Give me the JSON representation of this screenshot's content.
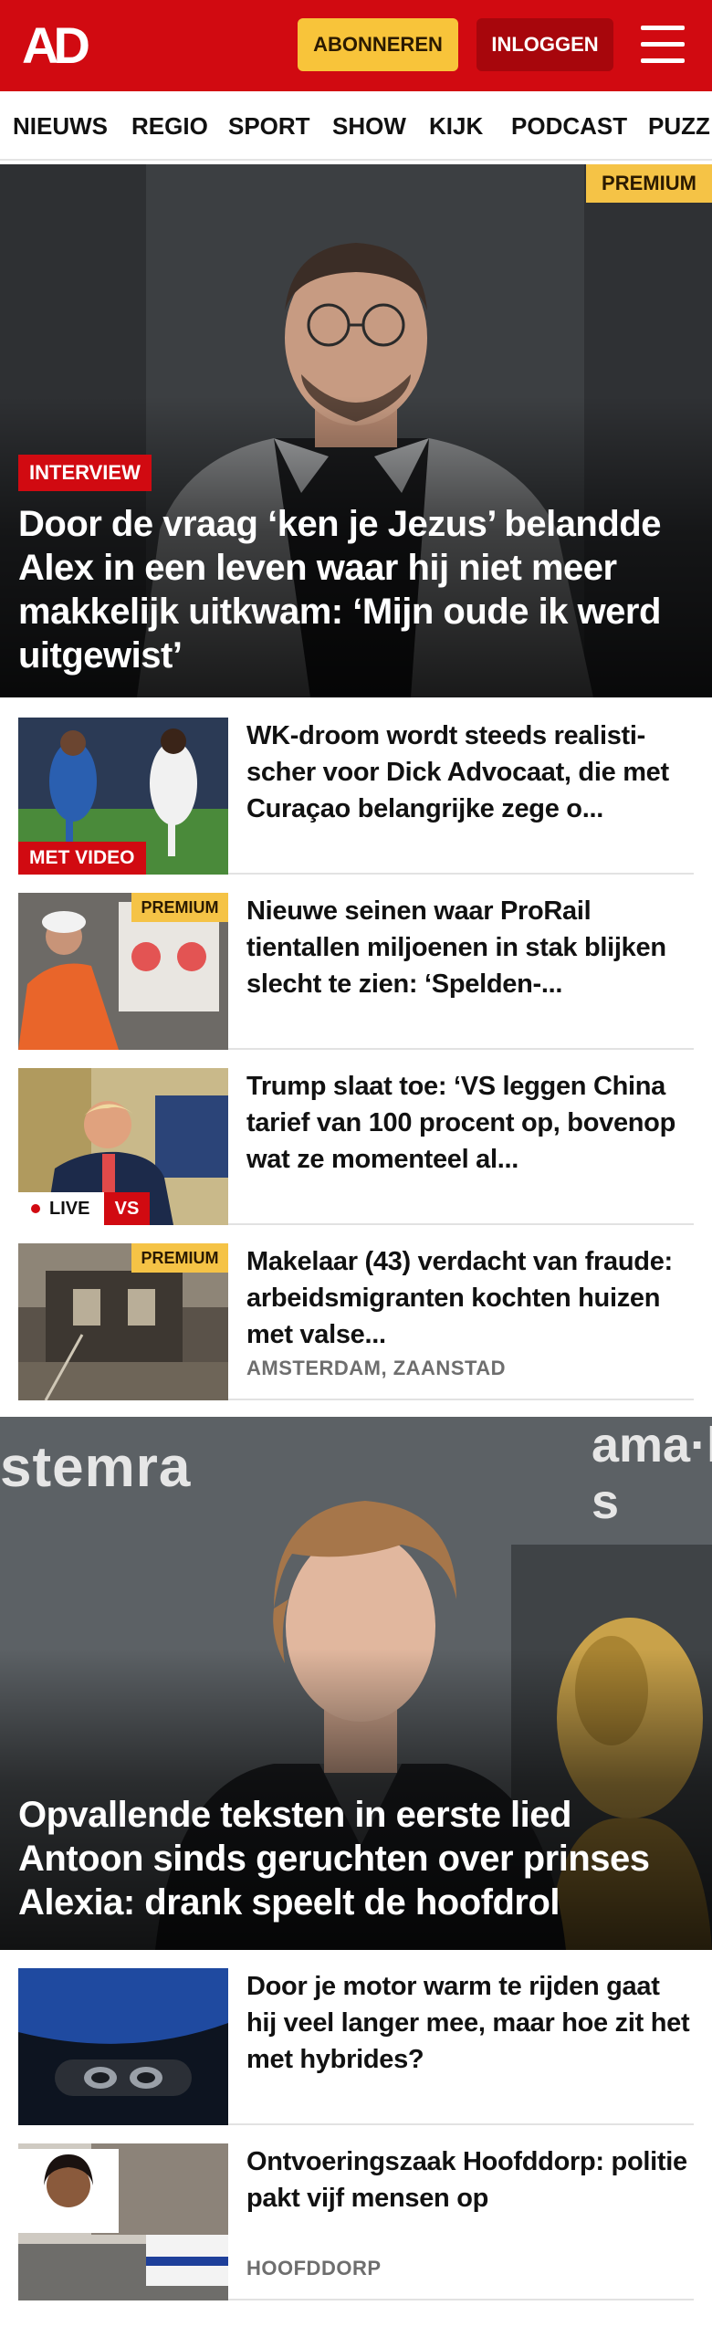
{
  "header": {
    "logo": "AD",
    "subscribe_label": "ABONNEREN",
    "login_label": "INLOGGEN",
    "menu_icon": "hamburger-menu-icon",
    "brand_color": "#d10a11",
    "accent_color": "#f8c43a"
  },
  "nav": {
    "items": [
      "NIEUWS",
      "REGIO",
      "SPORT",
      "SHOW",
      "KIJK",
      "PODCAST",
      "PUZZ"
    ]
  },
  "hero1": {
    "label": "INTERVIEW",
    "badge": "PREMIUM",
    "title": "Door de vraag ‘ken je Jezus’ belandde Alex in een leven waar hij niet meer makkelijk uitkwam: ‘Mijn oude ik werd uitgewist’"
  },
  "articles": [
    {
      "title": "WK-droom wordt steeds realisti­scher voor Dick Advocaat, die met Curaçao belangrijke zege o...",
      "label": "MET VIDEO"
    },
    {
      "title": "Nieuwe seinen waar ProRail tientallen miljoenen in stak blijken slecht te zien: ‘Spelden-...",
      "badge": "PREMIUM"
    },
    {
      "title": "Trump slaat toe: ‘VS leggen China tarief van 100 procent op, bovenop wat ze momenteel al...",
      "live": "LIVE",
      "tag": "VS"
    },
    {
      "title": "Makelaar (43) verdacht van fraude: arbeidsmigranten kochten huizen met valse...",
      "badge": "PREMIUM",
      "location": "AMSTERDAM, ZAANSTAD"
    }
  ],
  "hero2": {
    "backdrop_text_left": "stemra",
    "backdrop_text_right": "ama·ll s",
    "title": "Opvallende teksten in eerste lied Antoon sinds geruchten over prinses Alexia: drank speelt de hoofdrol"
  },
  "articles2": [
    {
      "title": "Door je motor warm te rijden gaat hij veel langer mee, maar hoe zit het met hybrides?"
    },
    {
      "title": "Ontvoeringszaak Hoofddorp: politie pakt vijf mensen op",
      "location": "HOOFDDORP"
    }
  ]
}
